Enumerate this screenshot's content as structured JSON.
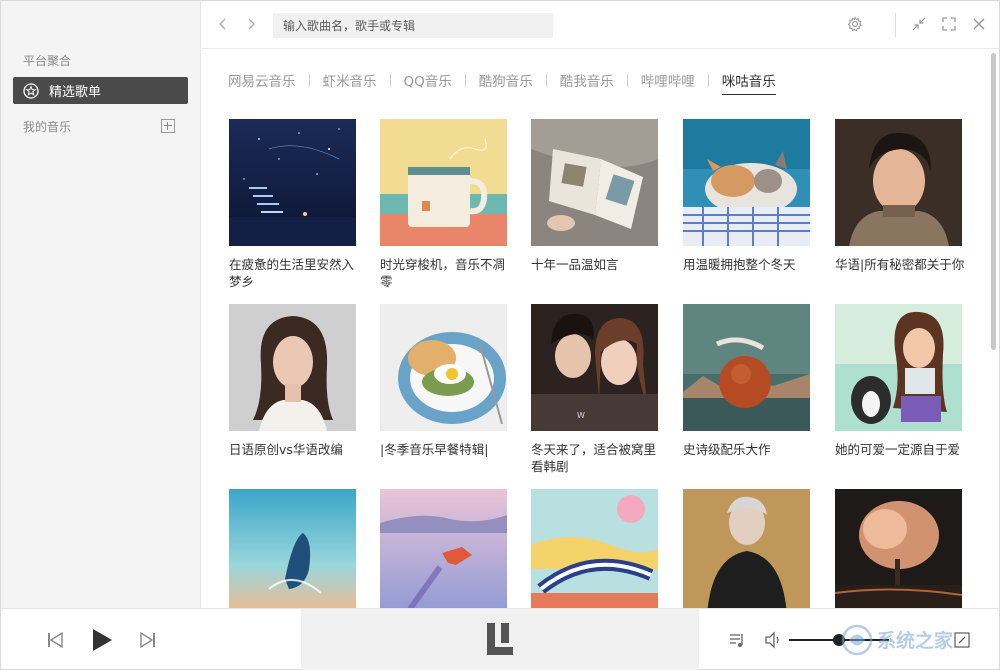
{
  "sidebar": {
    "section_platform": "平台聚合",
    "active_item": "精选歌单",
    "section_mymusic": "我的音乐"
  },
  "topbar": {
    "search_placeholder": "输入歌曲名，歌手或专辑"
  },
  "tabs": [
    {
      "label": "网易云音乐",
      "active": false
    },
    {
      "label": "虾米音乐",
      "active": false
    },
    {
      "label": "QQ音乐",
      "active": false
    },
    {
      "label": "酷狗音乐",
      "active": false
    },
    {
      "label": "酷我音乐",
      "active": false
    },
    {
      "label": "哔哩哔哩",
      "active": false
    },
    {
      "label": "咪咕音乐",
      "active": true
    }
  ],
  "playlists": [
    {
      "title": "在疲惫的生活里安然入梦乡"
    },
    {
      "title": "时光穿梭机，音乐不凋零"
    },
    {
      "title": "十年一品温如言"
    },
    {
      "title": "用温暖拥抱整个冬天"
    },
    {
      "title": "华语|所有秘密都关于你"
    },
    {
      "title": "日语原创vs华语改编"
    },
    {
      "title": "|冬季音乐早餐特辑|"
    },
    {
      "title": "冬天来了，适合被窝里看韩剧"
    },
    {
      "title": "史诗级配乐大作"
    },
    {
      "title": "她的可爱一定源自于爱"
    },
    {
      "title": ""
    },
    {
      "title": ""
    },
    {
      "title": ""
    },
    {
      "title": ""
    },
    {
      "title": ""
    }
  ],
  "player": {
    "volume_level": 0.5
  },
  "watermark_text": "系统之家"
}
